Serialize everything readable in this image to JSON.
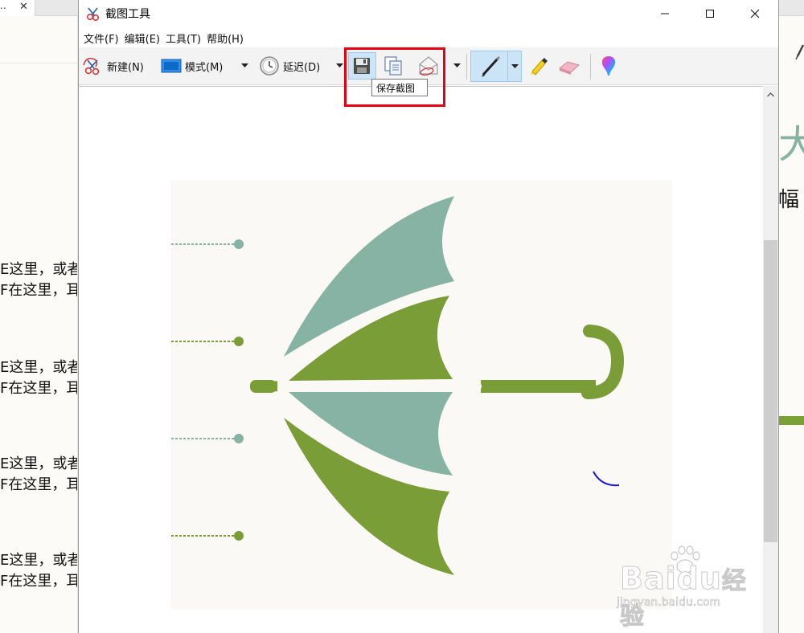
{
  "window": {
    "title": "截图工具",
    "tooltip": "保存截图"
  },
  "menu": {
    "items": [
      "文件(F)",
      "编辑(E)",
      "工具(T)",
      "帮助(H)"
    ]
  },
  "toolbar": {
    "new_label": "新建(N)",
    "mode_label": "模式(M)",
    "delay_label": "延迟(D)"
  },
  "background_doc": {
    "tab_trailing": "..",
    "left_lines": [
      "E这里，或者",
      "F在这里，耳",
      "E这里，或者",
      "F在这里，耳",
      "E这里，或者",
      "F在这里，耳",
      "E这里，或者",
      "F在这里，耳"
    ],
    "right_big_glyph": "大",
    "right_small_glyph": "幅"
  },
  "watermark": {
    "brand": "Bai",
    "brand_mid": "du",
    "brand_tail": "经验",
    "url": "jingyan.baidu.com"
  },
  "colors": {
    "umbrella_teal": "#86b3a4",
    "umbrella_green": "#7a9d37",
    "highlight_red": "#e50012",
    "pen_blue": "#1a1ad6",
    "toolbar_active": "#cce4f7"
  }
}
